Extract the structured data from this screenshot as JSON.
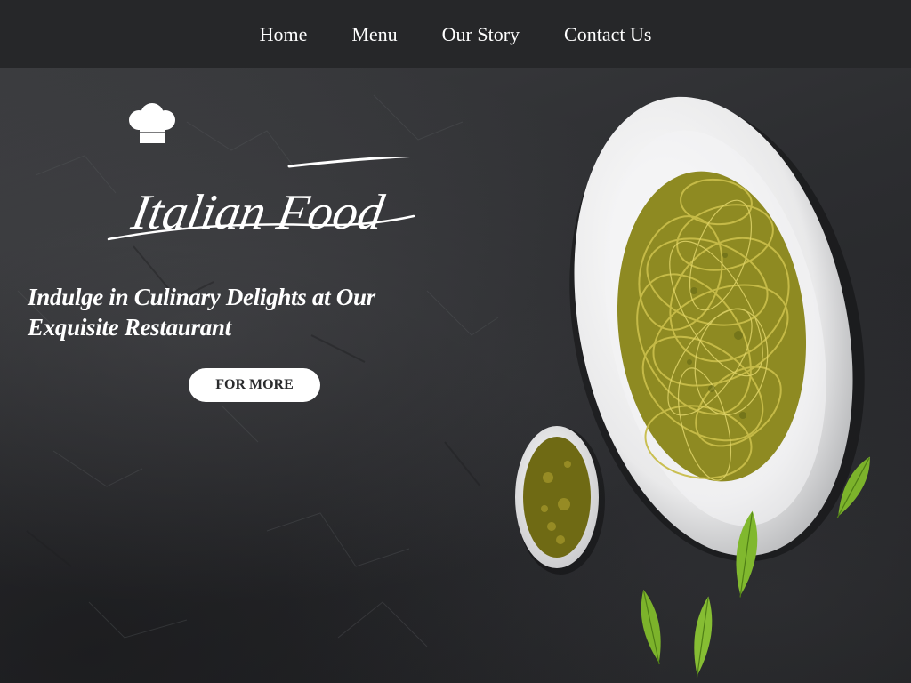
{
  "nav": {
    "items": [
      {
        "label": "Home"
      },
      {
        "label": "Menu"
      },
      {
        "label": "Our Story"
      },
      {
        "label": "Contact Us"
      }
    ]
  },
  "hero": {
    "logo_text": "Italian Food",
    "tagline_line1": "Indulge in Culinary Delights at Our",
    "tagline_line2": "Exquisite Restaurant",
    "cta_label": "FOR MORE"
  },
  "icons": [
    "chef-hat-icon"
  ],
  "colors": {
    "navbar": "#262729",
    "hero_background": "#2d2e31",
    "text": "#ffffff",
    "button_background": "#ffffff",
    "button_text": "#2a2b2d",
    "pesto": "#a9a22a",
    "basil": "#7cb32b"
  }
}
